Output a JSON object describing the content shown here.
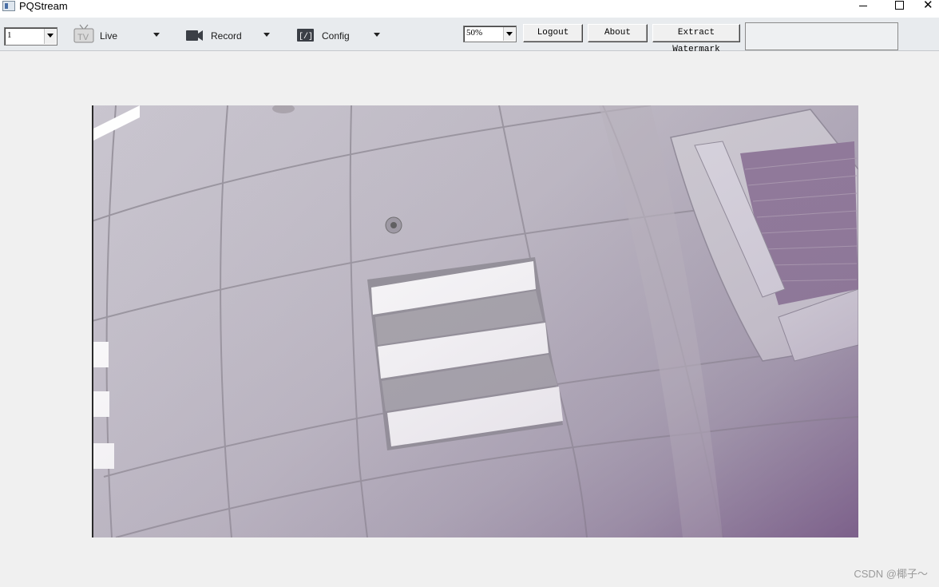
{
  "window": {
    "title": "PQStream"
  },
  "toolbar": {
    "channel_value": "1",
    "live_label": "Live",
    "record_label": "Record",
    "config_label": "Config",
    "zoom_value": "50%",
    "logout_label": "Logout",
    "about_label": "About",
    "extract_label": "Extract Watermark"
  },
  "icons": {
    "app": "app-icon",
    "live": "tv-icon",
    "record": "video-camera-icon",
    "config": "config-brackets-icon"
  },
  "footer": {
    "watermark": "CSDN @椰子～"
  }
}
